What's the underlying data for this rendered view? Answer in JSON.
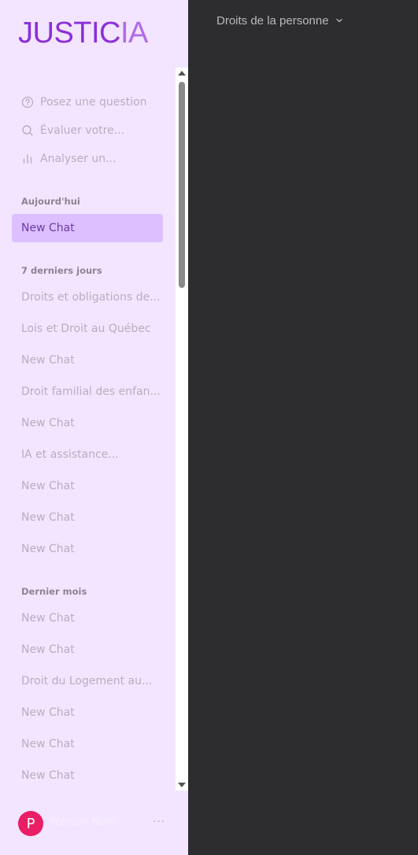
{
  "app": {
    "logo_main": "JUSTIC",
    "logo_ia": "IA"
  },
  "quick_actions": [
    {
      "label": "Posez une question",
      "icon": "question-circle-icon"
    },
    {
      "label": "Évaluer votre...",
      "icon": "search-icon"
    },
    {
      "label": "Analyser un...",
      "icon": "bar-chart-icon"
    }
  ],
  "sections": {
    "today": "Aujourd'hui",
    "last7": "7 derniers jours",
    "lastMonth": "Dernier mois"
  },
  "today_chats": [
    "New Chat"
  ],
  "last7_chats": [
    "Droits et obligations de...",
    "Lois et Droit au Québec",
    "New Chat",
    "Droit familial des enfan...",
    "New Chat",
    "IA et assistance...",
    "New Chat",
    "New Chat",
    "New Chat"
  ],
  "last_month_chats": [
    "New Chat",
    "New Chat",
    "Droit du Logement au...",
    "New Chat",
    "New Chat",
    "New Chat"
  ],
  "user": {
    "initial": "P",
    "name": "Prénom Nom",
    "more": "···"
  },
  "topic_selector": {
    "label": "Droits de la personne"
  },
  "colors": {
    "accent": "#8b2fd9",
    "sidebar_bg": "#f3e5ff",
    "active_item": "#ddbfff",
    "main_bg": "#2d2d2f",
    "avatar": "#e91e63"
  }
}
